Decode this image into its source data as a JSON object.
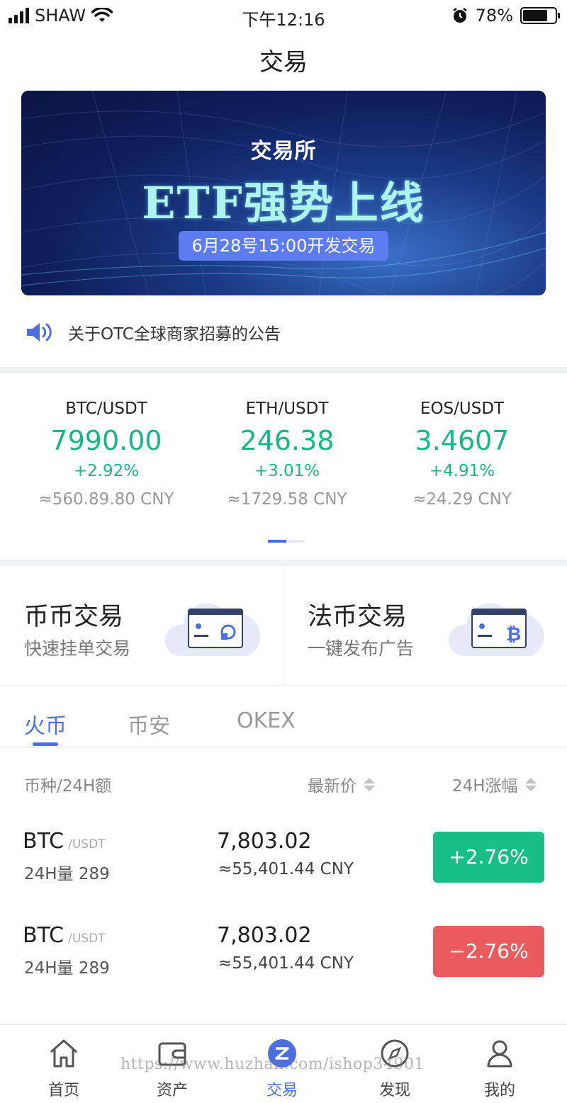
{
  "status_bar": {
    "carrier": "SHAW",
    "time": "下午12:16",
    "battery": "78%",
    "battery_level": 0.78
  },
  "nav": {
    "title": "交易"
  },
  "banner": {
    "small_text": "交易所",
    "headline": "ETF强势上线",
    "date_pill": "6月28号15:00开发交易"
  },
  "notice": {
    "text": "关于OTC全球商家招募的公告"
  },
  "tickers": [
    {
      "pair": "BTC/USDT",
      "price": "7990.00",
      "change": "+2.92%",
      "cny": "≈560.89.80 CNY"
    },
    {
      "pair": "ETH/USDT",
      "price": "246.38",
      "change": "+3.01%",
      "cny": "≈1729.58 CNY"
    },
    {
      "pair": "EOS/USDT",
      "price": "3.4607",
      "change": "+4.91%",
      "cny": "≈24.29 CNY"
    }
  ],
  "trade_cards": [
    {
      "title": "币币交易",
      "subtitle": "快速挂单交易"
    },
    {
      "title": "法币交易",
      "subtitle": "一键发布广告"
    }
  ],
  "exchange_tabs": [
    "火币",
    "币安",
    "OKEX"
  ],
  "list_header": {
    "coin": "币种/24H额",
    "price": "最新价",
    "change": "24H涨幅"
  },
  "rows": [
    {
      "symbol": "BTC",
      "quote": "/USDT",
      "volume": "24H量 289",
      "price": "7,803.02",
      "cny": "≈55,401.44 CNY",
      "change": "+2.76%",
      "color": "#17be88"
    },
    {
      "symbol": "BTC",
      "quote": "/USDT",
      "volume": "24H量 289",
      "price": "7,803.02",
      "cny": "≈55,401.44 CNY",
      "change": "−2.76%",
      "color": "#ea5b5e"
    }
  ],
  "tabbar": [
    "首页",
    "资产",
    "交易",
    "发现",
    "我的"
  ],
  "watermark": "https://www.huzhan.com/ishop34901",
  "colors": {
    "accent": "#4b6fe0",
    "up": "#13b886",
    "down": "#ea5b5e"
  }
}
